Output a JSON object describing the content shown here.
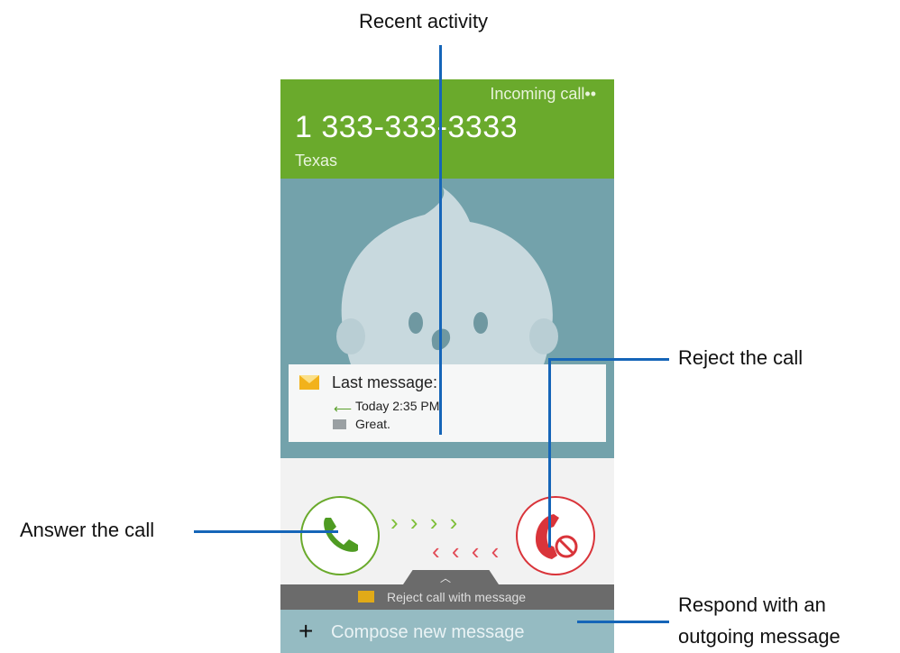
{
  "annotations": {
    "recent_activity": "Recent activity",
    "reject_call": "Reject the call",
    "answer_call": "Answer the call",
    "respond_line1": "Respond with an",
    "respond_line2": "outgoing message"
  },
  "call": {
    "status": "Incoming call••",
    "number": "1 333-333-3333",
    "location": "Texas"
  },
  "last_message": {
    "title": "Last message:",
    "time": "Today 2:35 PM",
    "text": "Great."
  },
  "actions": {
    "reject_with_message": "Reject call with message",
    "compose_new_message": "Compose new message",
    "plus_icon": "+"
  },
  "colors": {
    "header_green": "#6aaa2c",
    "answer_green": "#6aaa2c",
    "reject_red": "#d9343a",
    "callout_blue": "#1565b8"
  }
}
